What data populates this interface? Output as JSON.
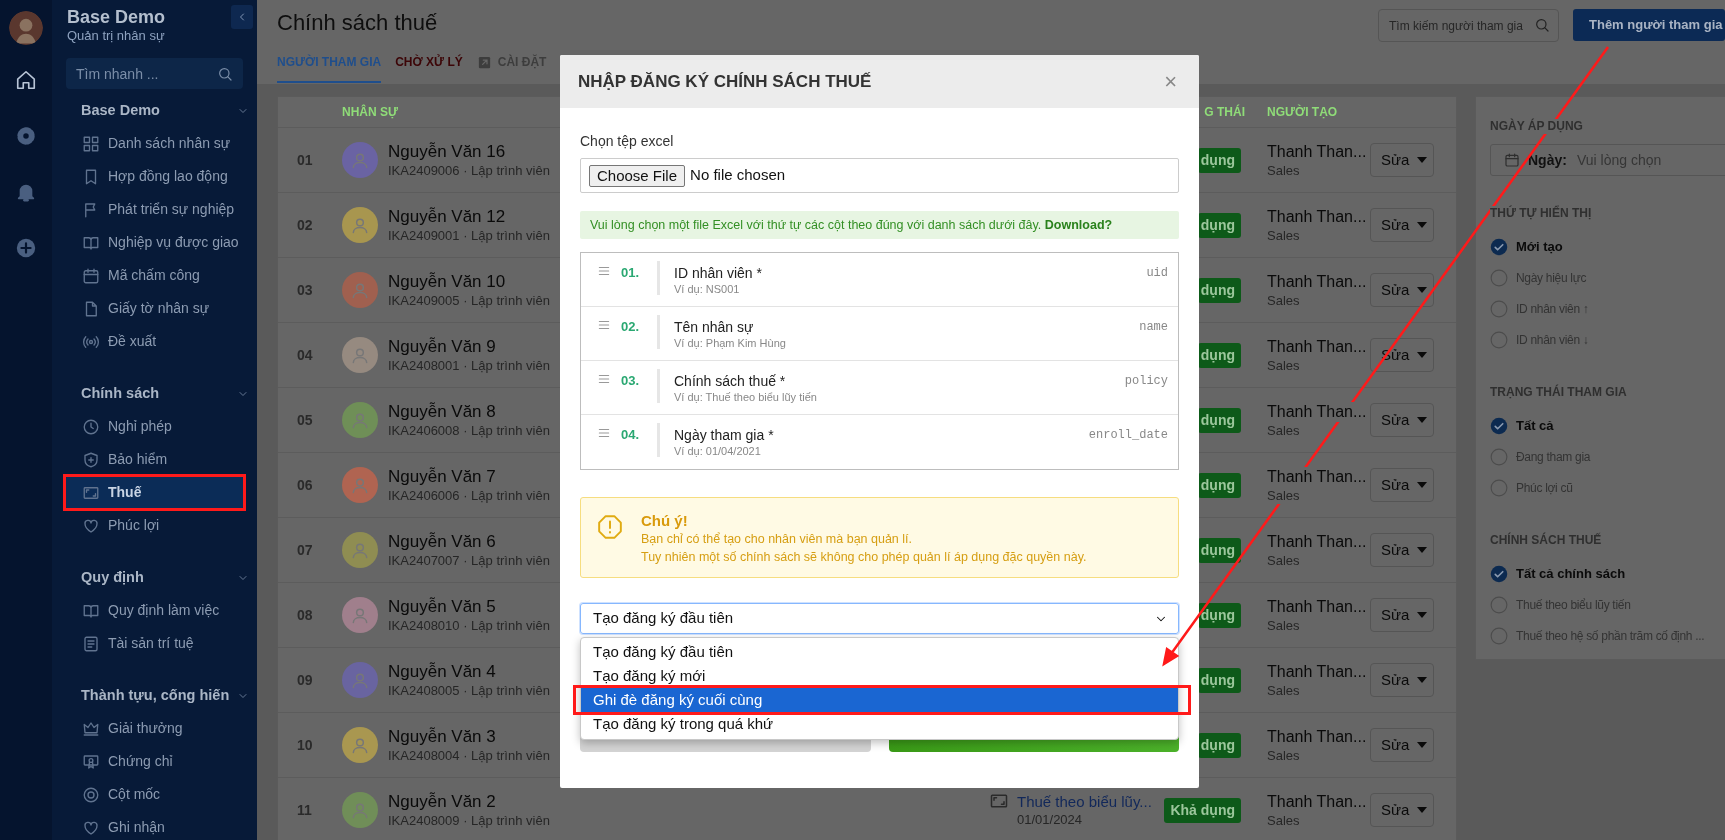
{
  "rail": [
    {
      "selected": true
    },
    {
      "selected": false
    },
    {
      "selected": false
    },
    {
      "selected": false
    }
  ],
  "sidebar": {
    "app_name": "Base Demo",
    "subtitle": "Quản trị nhân sự",
    "search": {
      "placeholder": "Tìm nhanh ..."
    },
    "groups": [
      {
        "title": "Base Demo",
        "expanded": true,
        "items": [
          {
            "label": "Danh sách nhân sự",
            "selected": false,
            "annotated": false
          },
          {
            "label": "Hợp đồng lao động",
            "selected": false,
            "annotated": false
          },
          {
            "label": "Phát triển sự nghiệp",
            "selected": false,
            "annotated": false
          },
          {
            "label": "Nghiệp vụ được giao",
            "selected": false,
            "annotated": false
          },
          {
            "label": "Mã chấm công",
            "selected": false,
            "annotated": false
          },
          {
            "label": "Giấy tờ nhân sự",
            "selected": false,
            "annotated": false
          },
          {
            "label": "Đề xuất",
            "selected": false,
            "annotated": false
          }
        ]
      },
      {
        "title": "Chính sách",
        "expanded": true,
        "items": [
          {
            "label": "Nghỉ phép",
            "selected": false,
            "annotated": false
          },
          {
            "label": "Bảo hiểm",
            "selected": false,
            "annotated": false
          },
          {
            "label": "Thuế",
            "selected": true,
            "annotated": true
          },
          {
            "label": "Phúc lợi",
            "selected": false,
            "annotated": false
          }
        ]
      },
      {
        "title": "Quy định",
        "expanded": true,
        "items": [
          {
            "label": "Quy định làm việc",
            "selected": false,
            "annotated": false
          },
          {
            "label": "Tài sản trí tuệ",
            "selected": false,
            "annotated": false
          }
        ]
      },
      {
        "title": "Thành tựu, cống hiến",
        "expanded": true,
        "items": [
          {
            "label": "Giải thưởng",
            "selected": false,
            "annotated": false
          },
          {
            "label": "Chứng chỉ",
            "selected": false,
            "annotated": false
          },
          {
            "label": "Cột mốc",
            "selected": false,
            "annotated": false
          },
          {
            "label": "Ghi nhận",
            "selected": false,
            "annotated": false
          }
        ]
      }
    ]
  },
  "page": {
    "title": "Chính sách thuế",
    "tabs": [
      {
        "label": "NGƯỜI THAM GIA",
        "selected": true,
        "color": "#1f4e8c",
        "kind": "plain"
      },
      {
        "label": "CHỜ XỬ LÝ",
        "selected": false,
        "color": "#3c0507",
        "kind": "plain"
      },
      {
        "label": "CÀI ĐẶT",
        "selected": false,
        "color": "#3d3d3d",
        "kind": "external"
      }
    ],
    "search": {
      "placeholder": "Tìm kiếm người tham gia"
    },
    "add_button": "Thêm người tham gia"
  },
  "table": {
    "columns": [
      {
        "label": "NHÂN SỰ"
      },
      {
        "label": "G THÁI"
      },
      {
        "label": "NGƯỜI TẠO"
      }
    ],
    "rows": [
      {
        "index": "01",
        "name": "Nguyễn Văn 16",
        "subtitle": "IKA2409006 · Lập trình viên",
        "color": "#6a63a3",
        "status": "dụng",
        "creator": "Thanh Than...",
        "creator_role": "Sales",
        "action": "Sửa"
      },
      {
        "index": "02",
        "name": "Nguyễn Văn 12",
        "subtitle": "IKA2409001 · Lập trình viên",
        "color": "#a8964f",
        "status": "dụng",
        "creator": "Thanh Than...",
        "creator_role": "Sales",
        "action": "Sửa"
      },
      {
        "index": "03",
        "name": "Nguyễn Văn 10",
        "subtitle": "IKA2409005 · Lập trình viên",
        "color": "#a0604f",
        "status": "dụng",
        "creator": "Thanh Than...",
        "creator_role": "Sales",
        "action": "Sửa"
      },
      {
        "index": "04",
        "name": "Nguyễn Văn 9",
        "subtitle": "IKA2408001 · Lập trình viên",
        "color": "#968a80",
        "status": "dụng",
        "creator": "Thanh Than...",
        "creator_role": "Sales",
        "action": "Sửa"
      },
      {
        "index": "05",
        "name": "Nguyễn Văn 8",
        "subtitle": "IKA2406008 · Lập trình viên",
        "color": "#6f8f57",
        "status": "dụng",
        "creator": "Thanh Than...",
        "creator_role": "Sales",
        "action": "Sửa"
      },
      {
        "index": "06",
        "name": "Nguyễn Văn 7",
        "subtitle": "IKA2406006 · Lập trình viên",
        "color": "#b06451",
        "status": "dụng",
        "creator": "Thanh Than...",
        "creator_role": "Sales",
        "action": "Sửa"
      },
      {
        "index": "07",
        "name": "Nguyễn Văn 6",
        "subtitle": "IKA2407007 · Lập trình viên",
        "color": "#8f8d52",
        "status": "dụng",
        "creator": "Thanh Than...",
        "creator_role": "Sales",
        "action": "Sửa"
      },
      {
        "index": "08",
        "name": "Nguyễn Văn 5",
        "subtitle": "IKA2408010 · Lập trình viên",
        "color": "#a07f8c",
        "status": "dụng",
        "creator": "Thanh Than...",
        "creator_role": "Sales",
        "action": "Sửa"
      },
      {
        "index": "09",
        "name": "Nguyễn Văn 4",
        "subtitle": "IKA2408005 · Lập trình viên",
        "color": "#6964a0",
        "status": "dụng",
        "creator": "Thanh Than...",
        "creator_role": "Sales",
        "action": "Sửa"
      },
      {
        "index": "10",
        "name": "Nguyễn Văn 3",
        "subtitle": "IKA2408004 · Lập trình viên",
        "color": "#a99750",
        "status": "dụng",
        "creator": "Thanh Than...",
        "creator_role": "Sales",
        "action": "Sửa"
      },
      {
        "index": "11",
        "name": "Nguyễn Văn 2",
        "subtitle": "IKA2408009 · Lập trình viên",
        "color": "#708e58",
        "policy": "Thuế theo biểu lũy...",
        "policy_date": "01/01/2024",
        "status": "Khả dụng",
        "creator": "Thanh Than...",
        "creator_role": "Sales",
        "action": "Sửa"
      }
    ]
  },
  "filters": {
    "sections": [
      {
        "title": "NGÀY ÁP DỤNG",
        "kind": "date",
        "field_label": "Ngày:",
        "placeholder": "Vui lòng chọn"
      },
      {
        "title": "THỨ TỰ HIỂN THỊ",
        "kind": "radio",
        "options": [
          {
            "label": "Mới tạo",
            "selected": true
          },
          {
            "label": "Ngày hiệu lực",
            "selected": false
          },
          {
            "label": "ID nhân viên ↑",
            "selected": false
          },
          {
            "label": "ID nhân viên ↓",
            "selected": false
          }
        ]
      },
      {
        "title": "TRẠNG THÁI THAM GIA",
        "kind": "radio",
        "options": [
          {
            "label": "Tất cả",
            "selected": true
          },
          {
            "label": "Đang tham gia",
            "selected": false
          },
          {
            "label": "Phúc lợi cũ",
            "selected": false
          }
        ]
      },
      {
        "title": "CHÍNH SÁCH THUẾ",
        "kind": "radio",
        "options": [
          {
            "label": "Tất cả chính sách",
            "selected": true
          },
          {
            "label": "Thuế theo biểu lũy tiến",
            "selected": false
          },
          {
            "label": "Thuế theo hệ số phần trăm cố định ...",
            "selected": false
          }
        ]
      }
    ]
  },
  "modal": {
    "title": "NHẬP ĐĂNG KÝ CHÍNH SÁCH THUẾ",
    "close": "×",
    "file_label": "Chọn tệp excel",
    "file_button": "Choose File",
    "file_status": "No file chosen",
    "hint": "Vui lòng chọn một file Excel với thứ tự các cột theo đúng với danh sách dưới đây.",
    "hint_link": "Download?",
    "columns": [
      {
        "number": "01.",
        "title": "ID nhân viên *",
        "example": "Ví dụ: NS001",
        "key": "uid"
      },
      {
        "number": "02.",
        "title": "Tên nhân sự",
        "example": "Ví dụ: Phạm Kim Hùng",
        "key": "name"
      },
      {
        "number": "03.",
        "title": "Chính sách thuế *",
        "example": "Ví dụ: Thuế theo biểu lũy tiến",
        "key": "policy"
      },
      {
        "number": "04.",
        "title": "Ngày tham gia *",
        "example": "Ví dụ: 01/04/2021",
        "key": "enroll_date"
      }
    ],
    "notice": {
      "title": "Chú ý!",
      "lines": [
        "Bạn chỉ có thể tạo cho nhân viên mà bạn quản lí.",
        "Tuy nhiên một số chính sách sẽ không cho phép quản lí áp dụng đặc quyền này."
      ]
    },
    "mode_select": {
      "value": "Tạo đăng ký đầu tiên",
      "expanded": true,
      "options": [
        {
          "label": "Tạo đăng ký đầu tiên",
          "highlighted": false,
          "annotated": false
        },
        {
          "label": "Tạo đăng ký mới",
          "highlighted": false,
          "annotated": false
        },
        {
          "label": "Ghi đè đăng ký cuối cùng",
          "highlighted": true,
          "annotated": true
        },
        {
          "label": "Tạo đăng ký trong quá khứ",
          "highlighted": false,
          "annotated": false
        }
      ]
    }
  },
  "annotation_arrow": true
}
